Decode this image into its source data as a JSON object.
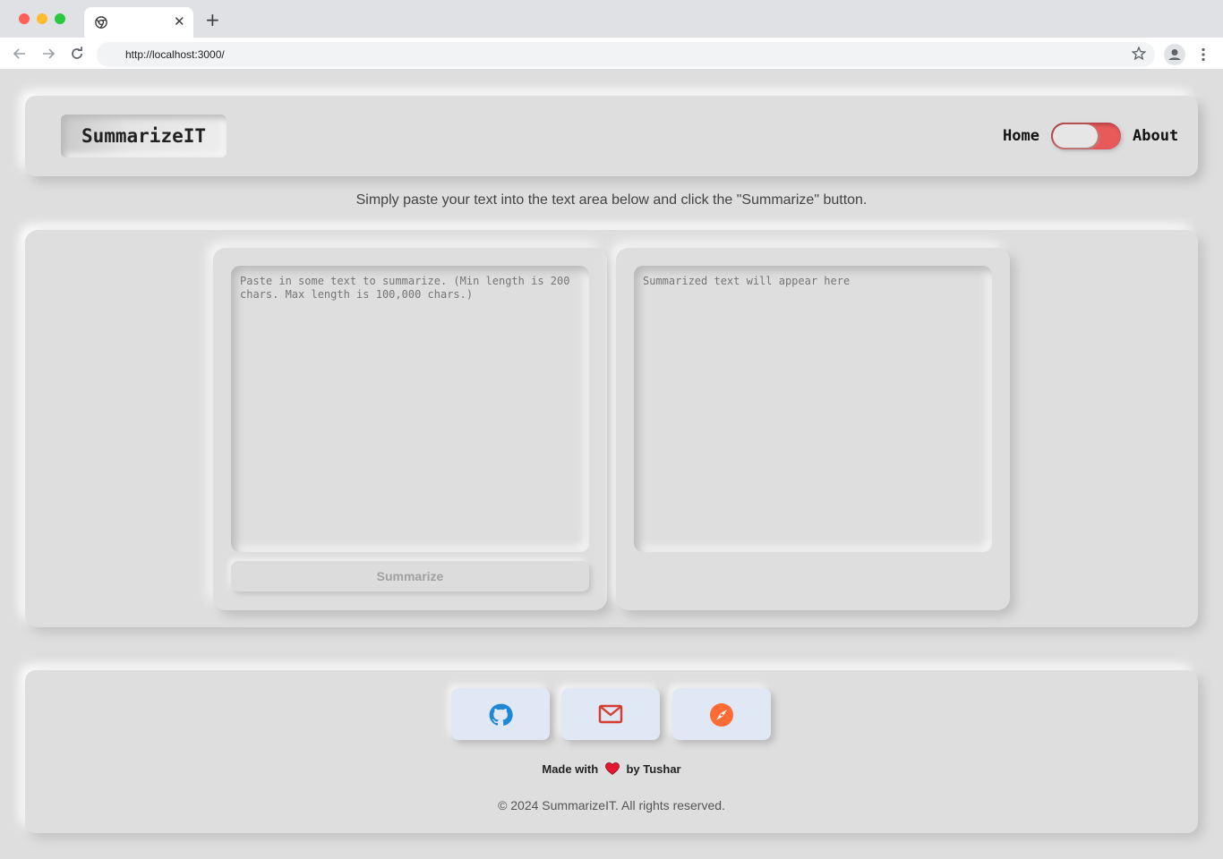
{
  "browser": {
    "tab_close": "✕",
    "new_tab": "+",
    "url": "http://localhost:3000/"
  },
  "header": {
    "logo": "SummarizeIT",
    "nav_home": "Home",
    "nav_about": "About",
    "toggle_on": true,
    "toggle_color": "#e85a5a"
  },
  "intro": "Simply paste your text into the text area below and click the \"Summarize\" button.",
  "input": {
    "placeholder": "Paste in some text to summarize. (Min length is 200 chars. Max length is 100,000 chars.)",
    "button": "Summarize"
  },
  "output": {
    "placeholder": "Summarized text will appear here"
  },
  "footer": {
    "links": [
      {
        "icon": "github-icon",
        "color": "#1e88d6"
      },
      {
        "icon": "mail-icon",
        "color": "#d63b2f"
      },
      {
        "icon": "compass-icon",
        "color": "#ff6b35"
      }
    ],
    "made_prefix": "Made with",
    "made_suffix": "by Tushar",
    "copyright": "© 2024 SummarizeIT. All rights reserved."
  }
}
